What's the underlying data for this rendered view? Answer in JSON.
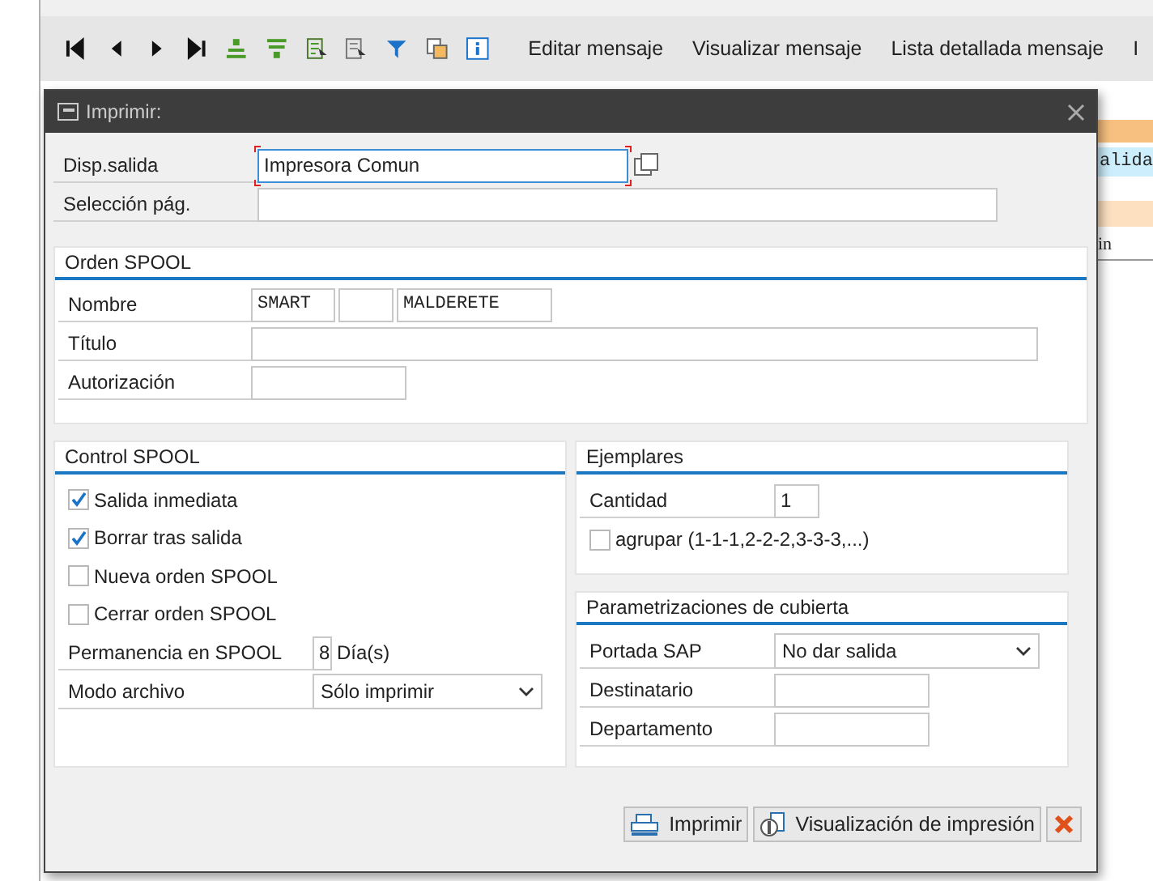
{
  "toolbar": {
    "buttons": [
      "Editar mensaje",
      "Visualizar mensaje",
      "Lista detallada mensaje",
      "I"
    ]
  },
  "background": {
    "cells": [
      "alida",
      "in"
    ]
  },
  "dialog": {
    "title": "Imprimir:",
    "output_device": {
      "label": "Disp.salida",
      "value": "Impresora Comun"
    },
    "page_selection": {
      "label": "Selección pág."
    },
    "orden_spool": {
      "title": "Orden SPOOL",
      "nombre": {
        "label": "Nombre",
        "part_1": "SMART",
        "part_3": "MALDERETE"
      },
      "titulo": {
        "label": "Título"
      },
      "autorizacion": {
        "label": "Autorización"
      }
    },
    "control_spool": {
      "title": "Control SPOOL",
      "checkboxes": [
        {
          "label": "Salida inmediata",
          "checked": true
        },
        {
          "label": "Borrar tras salida",
          "checked": true
        },
        {
          "label": "Nueva orden SPOOL",
          "checked": false
        },
        {
          "label": "Cerrar orden SPOOL",
          "checked": false
        }
      ],
      "permanencia": {
        "label": "Permanencia en SPOOL",
        "value": "8",
        "unit": "Día(s)"
      },
      "modo_archivo": {
        "label": "Modo archivo",
        "value": "Sólo imprimir"
      }
    },
    "ejemplares": {
      "title": "Ejemplares",
      "cantidad": {
        "label": "Cantidad",
        "value": "1"
      },
      "agrupar": {
        "label": "agrupar (1-1-1,2-2-2,3-3-3,...)",
        "checked": false
      }
    },
    "cubierta": {
      "title": "Parametrizaciones de cubierta",
      "portada": {
        "label": "Portada SAP",
        "value": "No dar salida"
      },
      "destinatario": {
        "label": "Destinatario"
      },
      "departamento": {
        "label": "Departamento"
      }
    },
    "buttons": [
      "Imprimir",
      "Visualización de impresión"
    ]
  }
}
